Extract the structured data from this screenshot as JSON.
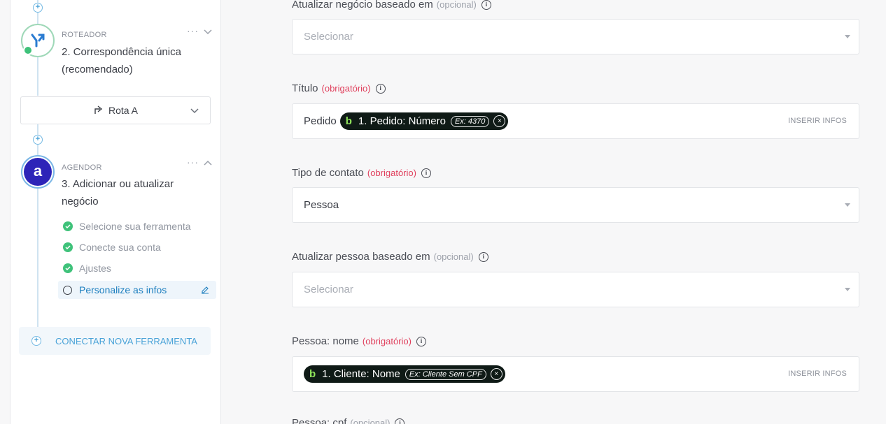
{
  "sidebar": {
    "step2": {
      "meta": "ROTEADOR",
      "title": "2. Correspondência única (recomendado)",
      "more": "···"
    },
    "route": {
      "label": "Rota A"
    },
    "step3": {
      "meta": "AGENDOR",
      "title": "3. Adicionar ou atualizar negócio",
      "more": "···"
    },
    "substeps": [
      {
        "label": "Selecione sua ferramenta"
      },
      {
        "label": "Conecte sua conta"
      },
      {
        "label": "Ajustes"
      },
      {
        "label": "Personalize as infos"
      }
    ],
    "connect": {
      "label": "CONECTAR NOVA FERRAMENTA"
    }
  },
  "fields": {
    "update_deal": {
      "label": "Atualizar negócio baseado em",
      "tag": "(opcional)",
      "placeholder": "Selecionar"
    },
    "title": {
      "label": "Título",
      "tag": "(obrigatório)",
      "prefix": "Pedido",
      "chip_label": "1. Pedido: Número",
      "chip_example": "Ex: 4370",
      "insert": "INSERIR INFOS"
    },
    "contact_type": {
      "label": "Tipo de contato",
      "tag": "(obrigatório)",
      "value": "Pessoa"
    },
    "update_person": {
      "label": "Atualizar pessoa baseado em",
      "tag": "(opcional)",
      "placeholder": "Selecionar"
    },
    "person_name": {
      "label": "Pessoa: nome",
      "tag": "(obrigatório)",
      "chip_label": "1. Cliente: Nome",
      "chip_example": "Ex: Cliente Sem CPF",
      "insert": "INSERIR INFOS"
    },
    "person_cpf": {
      "label": "Pessoa: cpf",
      "tag": "(opcional)"
    }
  },
  "colors": {
    "accent": "#1d7fbf",
    "required": "#e0405d",
    "success": "#3fc27a",
    "chip_bg": "#0f1a16",
    "chip_logo": "#8fe35b"
  }
}
